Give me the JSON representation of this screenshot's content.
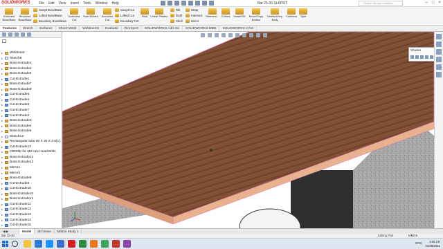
{
  "app": {
    "logo": "SOLIDWORKS",
    "title": "Bar 25-30.SLDPRT"
  },
  "menus": [
    "File",
    "Edit",
    "View",
    "Insert",
    "Tools",
    "Window",
    "Help"
  ],
  "search": {
    "placeholder": "Search file last modified"
  },
  "ribbon": {
    "extruded_boss": "Extruded Boss/Base",
    "revolved_boss": "Revolved Boss/Base",
    "swept_boss": "Swept Boss/Base",
    "lofted_boss": "Lofted Boss/Base",
    "boundary_boss": "Boundary Boss/Base",
    "extruded_cut": "Extruded Cut",
    "hole_wizard": "Hole Wizard",
    "revolved_cut": "Revolved Cut",
    "swept_cut": "Swept Cut",
    "lofted_cut": "Lofted Cut",
    "boundary_cut": "Boundary Cut",
    "fillet": "Fillet",
    "linear_pattern": "Linear Pattern",
    "rib": "Rib",
    "draft": "Draft",
    "shell": "Shell",
    "wrap": "Wrap",
    "intersect": "Intersect",
    "mirror": "Mirror",
    "reference": "Referenc...",
    "curves": "Curves",
    "instant3d": "Instant3D",
    "move_copy": "Move/Copy Bodies",
    "delete_keep": "Delete/Keep Body",
    "combine": "Combine",
    "split": "Split"
  },
  "tabs": [
    "Features",
    "Sketch",
    "Surfaces",
    "Sheet Metal",
    "Weldments",
    "Evaluate",
    "DimXpert",
    "SOLIDWORKS Add-Ins",
    "SOLIDWORKS MBD",
    "SOLIDWORKS CAM"
  ],
  "tree": [
    {
      "label": "Weldment",
      "icon": "weldment-icon"
    },
    {
      "label": "Sketch9",
      "icon": "sketch-icon"
    },
    {
      "label": "Boss-Extrude1",
      "icon": "boss-icon"
    },
    {
      "label": "Boss-Extrude2",
      "icon": "boss-icon"
    },
    {
      "label": "Boss-Extrude6",
      "icon": "boss-icon"
    },
    {
      "label": "Cut-Extrude1",
      "icon": "cut-icon"
    },
    {
      "label": "Boss-Extrude7",
      "icon": "boss-icon"
    },
    {
      "label": "Boss-Extrude8",
      "icon": "boss-icon"
    },
    {
      "label": "Cut-Extrude5",
      "icon": "cut-icon"
    },
    {
      "label": "Cut-Extrude4",
      "icon": "cut-icon"
    },
    {
      "label": "Cut-Extrude6",
      "icon": "cut-icon"
    },
    {
      "label": "Cut-Extrude7",
      "icon": "cut-icon"
    },
    {
      "label": "Cut-Extrude2",
      "icon": "cut-icon"
    },
    {
      "label": "Boss-Extrude3",
      "icon": "boss-icon"
    },
    {
      "label": "Boss-Extrude4",
      "icon": "boss-icon"
    },
    {
      "label": "Boss-Extrude5",
      "icon": "boss-icon"
    },
    {
      "label": "Sketch12",
      "icon": "sketch-icon"
    },
    {
      "label": "Rectangular tube 50 X 30 X 2.6(1)",
      "icon": "structural-icon"
    },
    {
      "label": "Cut-Extrude13",
      "icon": "cut-icon"
    },
    {
      "label": "CBORE for M6 Hex Head Bolt1",
      "icon": "hole-icon"
    },
    {
      "label": "Boss-Extrude12",
      "icon": "boss-icon"
    },
    {
      "label": "Boss-Extrude13",
      "icon": "boss-icon"
    },
    {
      "label": "Mirror1",
      "icon": "mirror-icon"
    },
    {
      "label": "Mirror2",
      "icon": "mirror-icon"
    },
    {
      "label": "Boss-Extrude9",
      "icon": "boss-icon"
    },
    {
      "label": "Cut-Extrude9",
      "icon": "cut-icon"
    },
    {
      "label": "Cut-Extrude10",
      "icon": "cut-icon"
    },
    {
      "label": "Boss-Extrude10",
      "icon": "boss-icon"
    },
    {
      "label": "Boss-Extrude11",
      "icon": "boss-icon"
    },
    {
      "label": "Cut-Extrude11",
      "icon": "cut-icon"
    },
    {
      "label": "Cut-Extrude12",
      "icon": "cut-icon"
    },
    {
      "label": "Cut-Extrude13",
      "icon": "cut-icon"
    },
    {
      "label": "Cut-Extrude14",
      "icon": "cut-icon"
    },
    {
      "label": "Cut-Extrude15",
      "icon": "cut-icon"
    }
  ],
  "shades_panel": {
    "title": "Shades"
  },
  "bottom_tabs": [
    "Model",
    "3D Views",
    "Motion Study 1"
  ],
  "status": {
    "left": "Bar 25-30",
    "mode": "Editing Part",
    "units": "MMGS"
  },
  "tray": {
    "lang": "ENG"
  },
  "clock": {
    "time": "3:05 CH",
    "date": "01/09/2021"
  },
  "colors": {
    "wood": "#7a4a30",
    "edge": "#e0a0a8",
    "accent": "#d02020"
  }
}
